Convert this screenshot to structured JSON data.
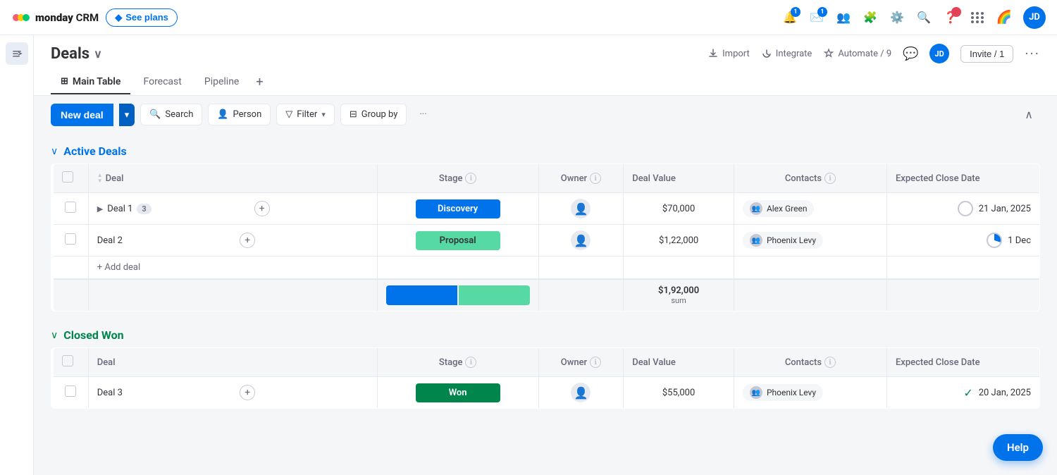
{
  "app": {
    "name": "monday",
    "brand": "CRM",
    "logo_colors": [
      "#00c875",
      "#0073ea"
    ]
  },
  "topnav": {
    "see_plans": "See plans",
    "notification_count": "1",
    "avatar_initials": "JD"
  },
  "board": {
    "title": "Deals",
    "tabs": [
      {
        "id": "main-table",
        "label": "Main Table",
        "active": true
      },
      {
        "id": "forecast",
        "label": "Forecast",
        "active": false
      },
      {
        "id": "pipeline",
        "label": "Pipeline",
        "active": false
      }
    ],
    "import_label": "Import",
    "integrate_label": "Integrate",
    "automate_label": "Automate / 9",
    "invite_label": "Invite / 1"
  },
  "toolbar": {
    "new_deal_label": "New deal",
    "search_label": "Search",
    "person_label": "Person",
    "filter_label": "Filter",
    "group_by_label": "Group by"
  },
  "groups": [
    {
      "id": "active-deals",
      "title": "Active Deals",
      "color": "#0073ea",
      "columns": [
        "Deal",
        "Stage",
        "Owner",
        "Deal Value",
        "Contacts",
        "Expected Close Date"
      ],
      "rows": [
        {
          "name": "Deal 1",
          "sub_count": "3",
          "stage": "Discovery",
          "stage_class": "stage-discovery",
          "owner": "",
          "value": "$70,000",
          "contact": "Alex Green",
          "date": "21 Jan, 2025",
          "date_status": "circle"
        },
        {
          "name": "Deal 2",
          "sub_count": "",
          "stage": "Proposal",
          "stage_class": "stage-proposal",
          "owner": "",
          "value": "$1,22,000",
          "contact": "Phoenix Levy",
          "date": "1 Dec",
          "date_status": "pie"
        }
      ],
      "sum_value": "$1,92,000",
      "sum_label": "sum"
    },
    {
      "id": "closed-won",
      "title": "Closed Won",
      "color": "#00854d",
      "columns": [
        "Deal",
        "Stage",
        "Owner",
        "Deal Value",
        "Contacts",
        "Expected Close Date"
      ],
      "rows": [
        {
          "name": "Deal 3",
          "sub_count": "",
          "stage": "Won",
          "stage_class": "stage-won",
          "owner": "",
          "value": "$55,000",
          "contact": "Phoenix Levy",
          "date": "20 Jan, 2025",
          "date_status": "check"
        }
      ]
    }
  ],
  "help": {
    "label": "Help"
  }
}
